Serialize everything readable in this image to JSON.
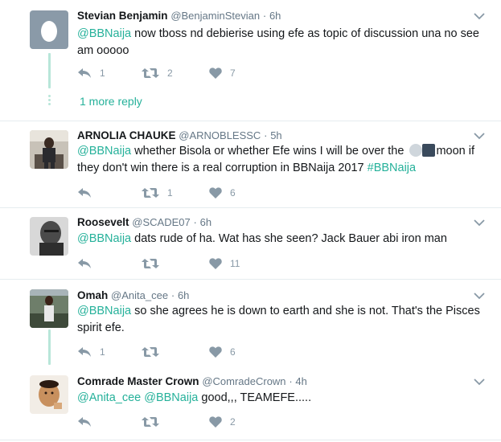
{
  "tweets": [
    {
      "name": "Stevian Benjamin",
      "handle": "@BenjaminStevian",
      "sep": "·",
      "time": "6h",
      "mention1": "@BBNaija",
      "body_a": " now tboss nd debierise using efe as topic of discussion una no see am ooooo",
      "replies": "1",
      "retweets": "2",
      "likes": "7"
    },
    {
      "name": "ARNOLIA CHAUKE",
      "handle": "@ARNOBLESSC",
      "sep": "·",
      "time": "5h",
      "mention1": "@BBNaija",
      "body_a": " whether Bisola or whether Efe wins I will be over the ",
      "body_b": "moon if they don't win there is a real corruption in BBNaija 2017 ",
      "hashtag": "#BBNaija",
      "replies": "",
      "retweets": "1",
      "likes": "6"
    },
    {
      "name": "Roosevelt",
      "handle": "@SCADE07",
      "sep": "·",
      "time": "6h",
      "mention1": "@BBNaija",
      "body_a": " dats rude of ha. Wat has she seen? Jack Bauer abi iron man",
      "replies": "",
      "retweets": "",
      "likes": "11"
    },
    {
      "name": "Omah",
      "handle": "@Anita_cee",
      "sep": "·",
      "time": "6h",
      "mention1": "@BBNaija",
      "body_a": " so she agrees he is down to earth and she is not. That's the Pisces spirit efe.",
      "replies": "1",
      "retweets": "",
      "likes": "6"
    },
    {
      "name": "Comrade Master Crown",
      "handle": "@ComradeCrown",
      "sep": "·",
      "time": "4h",
      "mention1": "@Anita_cee",
      "mention2": "@BBNaija",
      "body_a": " good,,, TEAMEFE.....",
      "replies": "",
      "retweets": "",
      "likes": "2"
    }
  ],
  "more_reply": "1 more reply",
  "icons": {
    "reply": "reply-icon",
    "retweet": "retweet-icon",
    "like": "heart-icon",
    "caret": "chevron-down-icon",
    "moon": "moon-emoji-icon",
    "city": "night-city-emoji-icon"
  },
  "colors": {
    "link": "#25b19a",
    "icon": "#8899a6",
    "thread": "#b8e6d9",
    "divider": "#e6ecf0"
  }
}
